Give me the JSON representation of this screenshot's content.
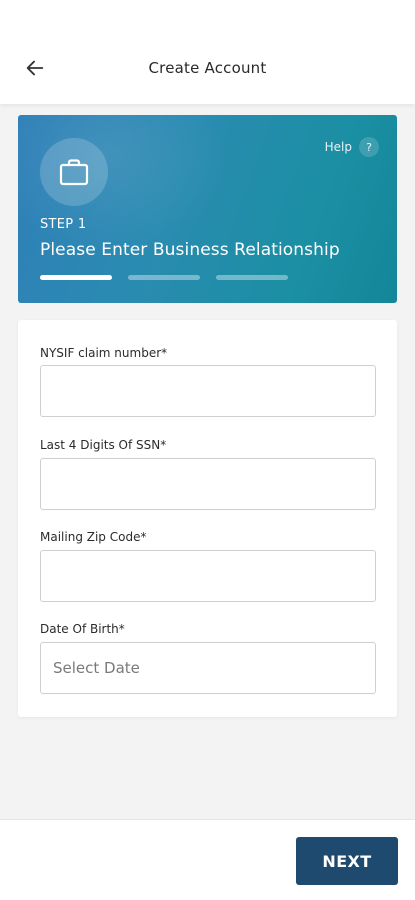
{
  "header": {
    "title": "Create Account",
    "back_icon": "arrow-left-icon"
  },
  "banner": {
    "icon": "briefcase-icon",
    "help_label": "Help",
    "help_icon": "?",
    "step_label": "STEP 1",
    "step_title": "Please Enter Business Relationship",
    "progress": {
      "total_steps": 3,
      "current_step": 1
    },
    "colors": {
      "gradient_start": "#2f7fb8",
      "gradient_end": "#14869a"
    }
  },
  "form": {
    "fields": [
      {
        "label": "NYSIF claim number*",
        "value": "",
        "placeholder": ""
      },
      {
        "label": "Last 4 Digits Of SSN*",
        "value": "",
        "placeholder": ""
      },
      {
        "label": "Mailing Zip Code*",
        "value": "",
        "placeholder": ""
      },
      {
        "label": "Date Of Birth*",
        "value": "",
        "placeholder": "Select Date"
      }
    ]
  },
  "footer": {
    "next_label": "NEXT",
    "next_color": "#1d4a6e"
  }
}
